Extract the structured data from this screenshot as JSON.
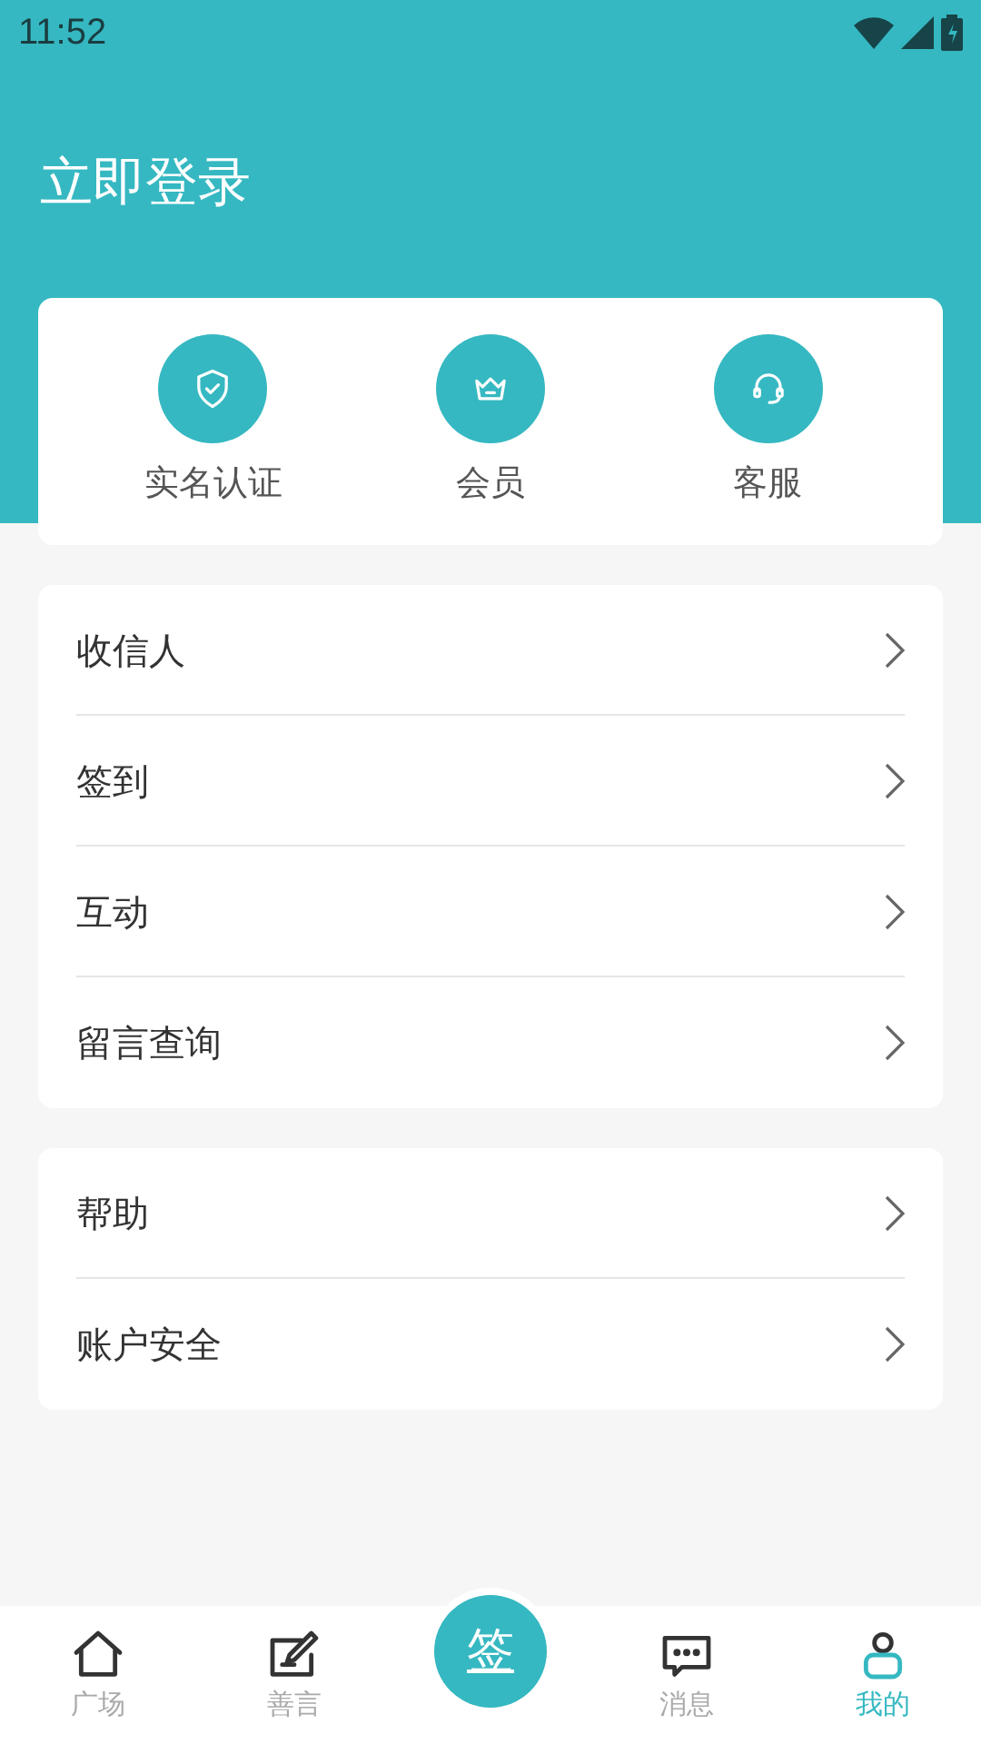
{
  "status_bar": {
    "time": "11:52"
  },
  "header": {
    "title": "立即登录"
  },
  "quick_actions": [
    {
      "label": "实名认证",
      "kind": "shield"
    },
    {
      "label": "会员",
      "kind": "crown"
    },
    {
      "label": "客服",
      "kind": "headset"
    }
  ],
  "menu_groups": [
    [
      "收信人",
      "签到",
      "互动",
      "留言查询"
    ],
    [
      "帮助",
      "账户安全"
    ]
  ],
  "bottom_nav": {
    "items": [
      {
        "label": "广场",
        "kind": "home",
        "selected": false
      },
      {
        "label": "善言",
        "kind": "edit",
        "selected": false
      },
      {
        "label": "消息",
        "kind": "chat",
        "selected": false
      },
      {
        "label": "我的",
        "kind": "user",
        "selected": true
      }
    ],
    "center_button": "签"
  }
}
